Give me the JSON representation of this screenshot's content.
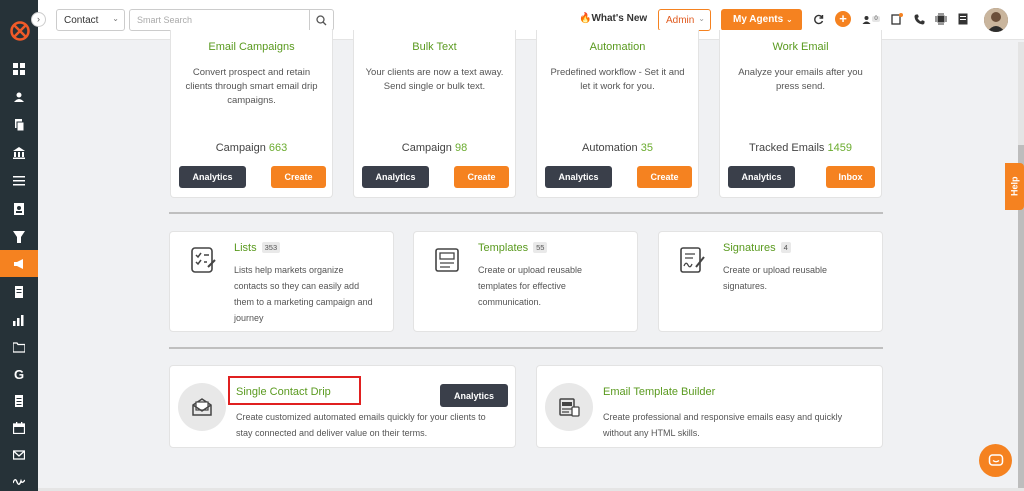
{
  "topbar": {
    "module_select": "Contact",
    "search_placeholder": "Smart Search",
    "whats_new": "What's New",
    "admin": "Admin",
    "my_agents": "My Agents",
    "notif_count": "0"
  },
  "help": "Help",
  "row1": [
    {
      "title": "Email Campaigns",
      "desc": "Convert prospect and retain clients through smart email drip campaigns.",
      "metric_label": "Campaign",
      "metric_value": "663",
      "analytics": "Analytics",
      "action": "Create"
    },
    {
      "title": "Bulk Text",
      "desc": "Your clients are now a text away. Send single or bulk text.",
      "metric_label": "Campaign",
      "metric_value": "98",
      "analytics": "Analytics",
      "action": "Create"
    },
    {
      "title": "Automation",
      "desc": "Predefined workflow - Set it and let it work for you.",
      "metric_label": "Automation",
      "metric_value": "35",
      "analytics": "Analytics",
      "action": "Create"
    },
    {
      "title": "Work Email",
      "desc": "Analyze your emails after you press send.",
      "metric_label": "Tracked Emails",
      "metric_value": "1459",
      "analytics": "Analytics",
      "action": "Inbox"
    }
  ],
  "row2": [
    {
      "title": "Lists",
      "count": "353",
      "desc": "Lists help markets organize contacts so they can easily add them to a marketing campaign and journey"
    },
    {
      "title": "Templates",
      "count": "55",
      "desc": "Create or upload reusable templates for effective communication."
    },
    {
      "title": "Signatures",
      "count": "4",
      "desc": "Create or upload reusable signatures."
    }
  ],
  "row3": [
    {
      "title": "Single Contact Drip",
      "desc": "Create customized automated emails quickly for your clients to stay connected and deliver value on their terms.",
      "analytics": "Analytics"
    },
    {
      "title": "Email Template Builder",
      "desc": "Create professional and responsive emails easy and quickly without any HTML skills."
    }
  ],
  "colors": {
    "accent": "#f58220",
    "sidebar": "#263238",
    "title_green": "#5a9a1f",
    "dark_button": "#3a3f4a",
    "highlight": "#e02020"
  }
}
